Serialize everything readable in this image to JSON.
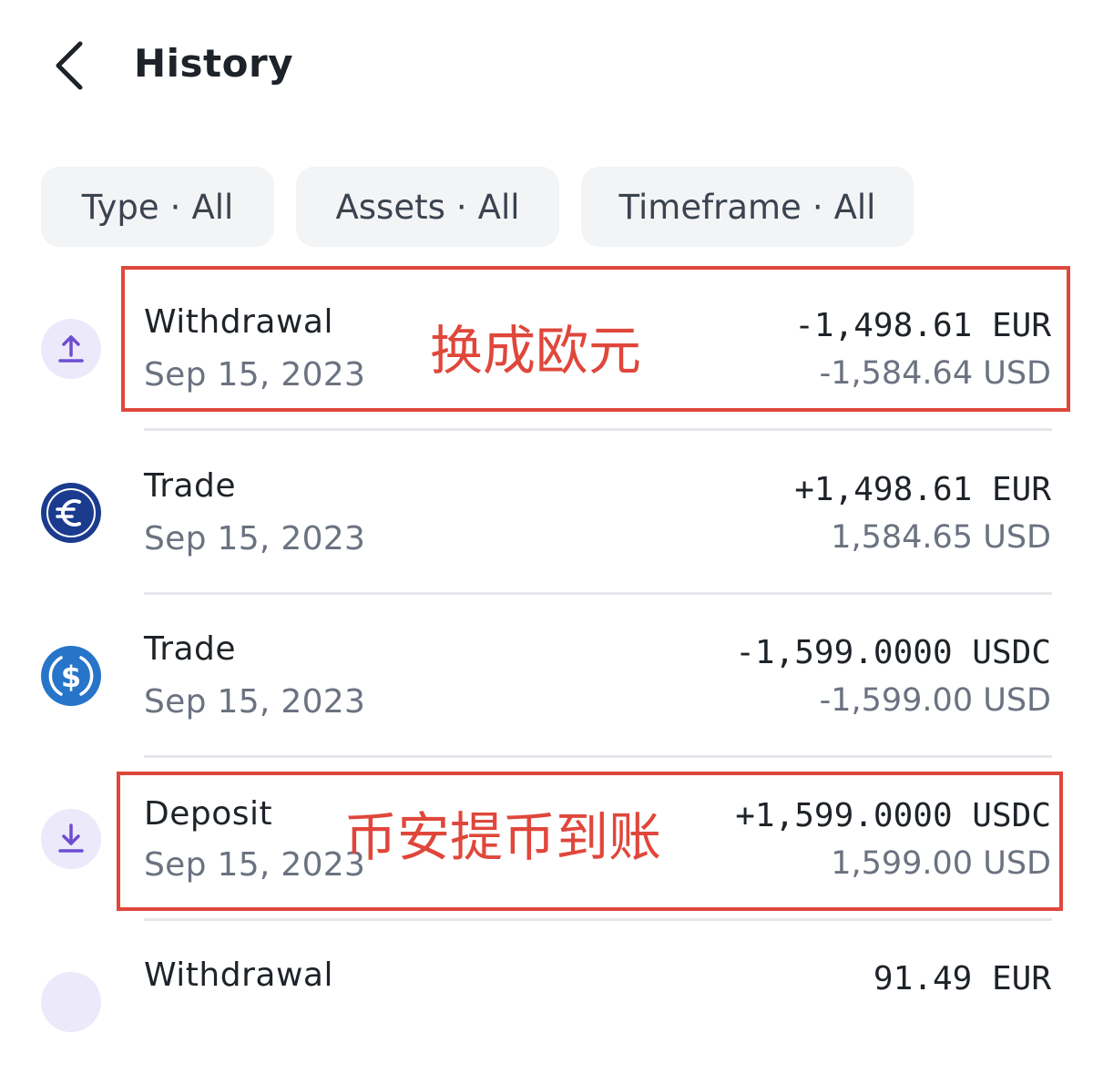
{
  "header": {
    "title": "History"
  },
  "filters": [
    {
      "name": "Type",
      "value": "All"
    },
    {
      "name": "Assets",
      "value": "All"
    },
    {
      "name": "Timeframe",
      "value": "All"
    }
  ],
  "filter_separator": "·",
  "transactions": [
    {
      "type": "Withdrawal",
      "date": "Sep 15, 2023",
      "amount": "-1,498.61 EUR",
      "usd": "-1,584.64 USD",
      "icon": "upload-arrow-icon"
    },
    {
      "type": "Trade",
      "date": "Sep 15, 2023",
      "amount": "+1,498.61 EUR",
      "usd": "1,584.65 USD",
      "icon": "euro-coin-icon"
    },
    {
      "type": "Trade",
      "date": "Sep 15, 2023",
      "amount": "-1,599.0000 USDC",
      "usd": "-1,599.00 USD",
      "icon": "usdc-coin-icon"
    },
    {
      "type": "Deposit",
      "date": "Sep 15, 2023",
      "amount": "+1,599.0000 USDC",
      "usd": "1,599.00 USD",
      "icon": "download-arrow-icon"
    },
    {
      "type": "Withdrawal",
      "date": "",
      "amount": "91.49 EUR",
      "usd": "",
      "icon": "upload-arrow-icon"
    }
  ],
  "annotations": [
    {
      "text": "换成欧元"
    },
    {
      "text": "币安提币到账"
    }
  ],
  "colors": {
    "highlight": "#e0473b",
    "icon_bg_purple": "#ece9fb",
    "icon_purple": "#6d4ed1",
    "euro_blue": "#1b3b8f",
    "usdc_blue": "#2775ca"
  }
}
